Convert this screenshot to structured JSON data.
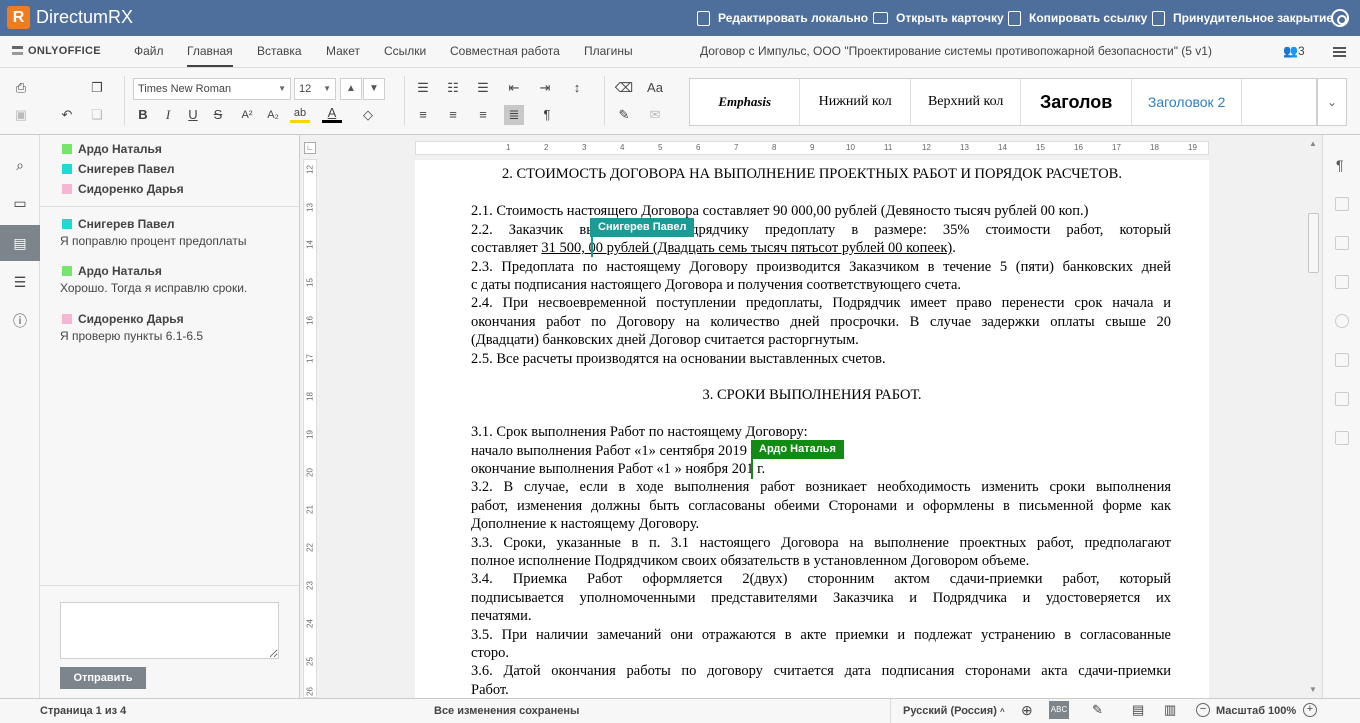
{
  "app": {
    "name": "DirectumRX",
    "logo": "R"
  },
  "top_actions": [
    {
      "label": "Редактировать локально",
      "icon": "word-doc-icon"
    },
    {
      "label": "Открыть карточку",
      "icon": "card-icon"
    },
    {
      "label": "Копировать ссылку",
      "icon": "copy-link-icon"
    },
    {
      "label": "Принудительное закрытие",
      "icon": "force-close-icon"
    }
  ],
  "menu": {
    "brand": "ONLYOFFICE",
    "tabs": [
      "Файл",
      "Главная",
      "Вставка",
      "Макет",
      "Ссылки",
      "Совместная работа",
      "Плагины"
    ],
    "active_tab": "Главная",
    "doc_title": "Договор с Импульс, ООО \"Проектирование системы противопожарной безопасности\" (5 v1)",
    "users_count": "3"
  },
  "toolbar": {
    "font_name": "Times New Roman",
    "font_size": "12",
    "bold": "B",
    "italic": "I",
    "underline": "U",
    "strike": "S",
    "superscript": "A²",
    "subscript": "A₂",
    "font_color": "A",
    "styles": [
      "Emphasis",
      "Нижний кол",
      "Верхний кол",
      "Заголов",
      "Заголовок 2",
      ""
    ]
  },
  "collab": {
    "users": [
      {
        "name": "Ардо Наталья",
        "color": "#77e56c"
      },
      {
        "name": "Снигерев Павел",
        "color": "#22d7d4"
      },
      {
        "name": "Сидоренко Дарья",
        "color": "#f6b6d3"
      }
    ],
    "comments": [
      {
        "author": "Снигерев Павел",
        "color": "#22d7d4",
        "text": "Я поправлю процент предоплаты"
      },
      {
        "author": "Ардо Наталья",
        "color": "#77e56c",
        "text": "Хорошо. Тогда я исправлю сроки."
      },
      {
        "author": "Сидоренко Дарья",
        "color": "#f6b6d3",
        "text": "Я проверю пункты 6.1-6.5"
      }
    ],
    "send_label": "Отправить"
  },
  "ruler": {
    "h": [
      "1",
      "2",
      "3",
      "4",
      "5",
      "6",
      "7",
      "8",
      "9",
      "10",
      "11",
      "12",
      "13",
      "14",
      "15",
      "16",
      "17",
      "18",
      "19"
    ],
    "v": [
      "12",
      "13",
      "14",
      "15",
      "16",
      "17",
      "18",
      "19",
      "20",
      "21",
      "22",
      "23",
      "24",
      "25",
      "26"
    ]
  },
  "document": {
    "section2_title": "2. СТОИМОСТЬ ДОГОВОРА НА ВЫПОЛНЕНИЕ ПРОЕКТНЫХ РАБОТ И ПОРЯДОК РАСЧЕТОВ.",
    "p2_1": "2.1. Стоимость настоящего Договора составляет 90 000,00 рублей (Девяносто тысяч рублей 00 коп.)",
    "p2_2a": "2.2. Заказчик выплачивает Подрядчику предоплату в размере: 35% стоимости работ, который",
    "p2_2b_pre": "составляет ",
    "p2_2b_ul": "31 500, 00 рублей (Двадцать семь тысяч пятьсот рублей 00 копеек)",
    "p2_2b_post": ".",
    "p2_3a": "2.3. Предоплата по настоящему Договору производится Заказчиком в течение 5 (пяти) банковских дней",
    "p2_3b": "с даты подписания настоящего Договора и получения соответствующего счета.",
    "p2_4a": "2.4. При несвоевременной поступлении предоплаты, Подрядчик имеет право перенести срок начала и",
    "p2_4b": "окончания работ по Договору на количество дней просрочки. В случае задержки оплаты свыше 20",
    "p2_4c": "(Двадцати) банковских дней Договор считается расторгнутым.",
    "p2_5": "2.5. Все расчеты производятся на основании выставленных счетов.",
    "section3_title": "3. СРОКИ ВЫПОЛНЕНИЯ РАБОТ.",
    "p3_1a": "3.1. Срок выполнения Работ по настоящему Договору:",
    "p3_1b": "начало выполнения Работ «1» сентября 2019 г.",
    "p3_1c": "окончание выполнения Работ «1 » ноября 201  г.",
    "p3_2a": "3.2. В случае, если в ходе выполнения работ возникает необходимость изменить сроки выполнения",
    "p3_2b": "работ, изменения должны быть согласованы обеими Сторонами и оформлены в письменной форме как",
    "p3_2c": "Дополнение к настоящему Договору.",
    "p3_3a": "3.3. Сроки, указанные в п. 3.1 настоящего Договора на выполнение проектных работ, предполагают",
    "p3_3b": "полное исполнение Подрядчиком своих обязательств в установленном Договором объеме.",
    "p3_4a": "3.4. Приемка Работ оформляется 2(двух) сторонним актом сдачи-приемки работ, который",
    "p3_4b": "подписывается уполномоченными представителями Заказчика и Подрядчика и удостоверяется их",
    "p3_4c": "печатями.",
    "p3_5a": "3.5. При наличии замечаний они отражаются в акте приемки и подлежат устранению в согласованные",
    "p3_5b": "сторо.",
    "p3_6a": "3.6. Датой окончания работы по договору считается дата подписания сторонами акта сдачи-приемки",
    "p3_6b": "Работ.",
    "cursor_tags": [
      {
        "name": "Снигерев Павел",
        "color": "#1c9b96"
      },
      {
        "name": "Ардо Наталья",
        "color": "#138a13"
      }
    ]
  },
  "status": {
    "page": "Страница 1 из 4",
    "saved": "Все изменения сохранены",
    "language": "Русский (Россия)",
    "zoom": "Масштаб 100%"
  }
}
